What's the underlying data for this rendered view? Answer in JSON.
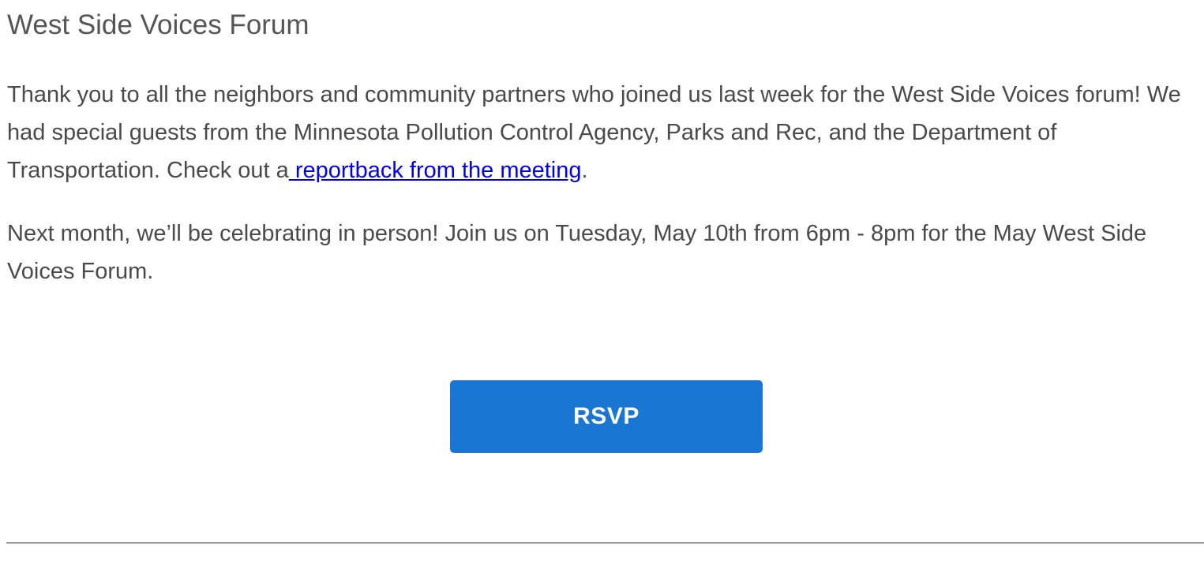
{
  "section": {
    "title": "West Side Voices Forum"
  },
  "paragraph1": {
    "text_before_link": "Thank you to all the neighbors and community partners who joined us last week for the West Side Voices forum! We had special guests from the Minnesota Pollution Control Agency, Parks and Rec, and the Department of Transportation. Check out a",
    "link_text": " reportback from the meeting",
    "text_after_link": "."
  },
  "paragraph2": {
    "text": "Next month, we’ll be celebrating in person! Join us on Tuesday, May 10th from 6pm - 8pm for the May West Side Voices Forum."
  },
  "cta": {
    "button_label": "RSVP"
  },
  "colors": {
    "button_bg": "#1976d2",
    "link": "#0000ee",
    "text": "#4a4a4a",
    "divider": "#9a9a9a"
  }
}
